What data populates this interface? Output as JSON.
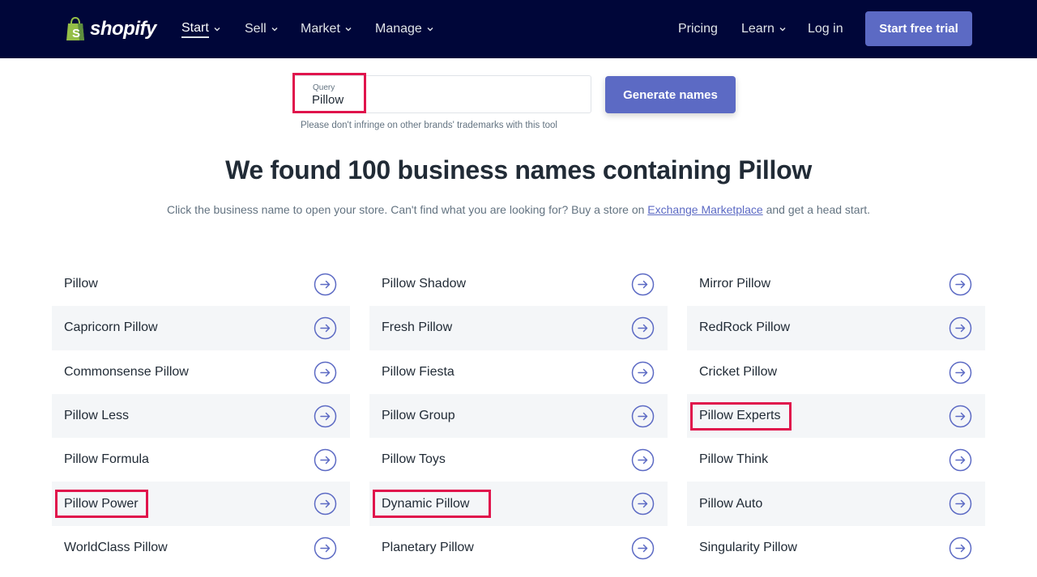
{
  "nav": {
    "logo_text": "shopify",
    "items": [
      {
        "label": "Start",
        "dropdown": true,
        "active": true
      },
      {
        "label": "Sell",
        "dropdown": true
      },
      {
        "label": "Market",
        "dropdown": true
      },
      {
        "label": "Manage",
        "dropdown": true
      }
    ],
    "right_items": [
      {
        "label": "Pricing",
        "dropdown": false
      },
      {
        "label": "Learn",
        "dropdown": true
      },
      {
        "label": "Log in",
        "dropdown": false
      }
    ],
    "cta_label": "Start free trial"
  },
  "search": {
    "label": "Query",
    "value": "Pillow",
    "button_label": "Generate names",
    "disclaimer": "Please don't infringe on other brands' trademarks with this tool"
  },
  "results": {
    "heading": "We found 100 business names containing Pillow",
    "sub_before": "Click the business name to open your store. Can't find what you are looking for? Buy a store on ",
    "sub_link": "Exchange Marketplace",
    "sub_after": " and get a head start.",
    "columns": [
      [
        "Pillow",
        "Capricorn Pillow",
        "Commonsense Pillow",
        "Pillow Less",
        "Pillow Formula",
        "Pillow Power",
        "WorldClass Pillow"
      ],
      [
        "Pillow Shadow",
        "Fresh Pillow",
        "Pillow Fiesta",
        "Pillow Group",
        "Pillow Toys",
        "Dynamic Pillow",
        "Planetary Pillow"
      ],
      [
        "Mirror Pillow",
        "RedRock Pillow",
        "Cricket Pillow",
        "Pillow Experts",
        "Pillow Think",
        "Pillow Auto",
        "Singularity Pillow"
      ]
    ],
    "highlighted": [
      "Pillow Power",
      "Dynamic Pillow",
      "Pillow Experts"
    ]
  },
  "colors": {
    "nav_bg": "#000639",
    "accent": "#5c6ac4",
    "annotation": "#e0144c",
    "logo_green": "#95bf47"
  }
}
